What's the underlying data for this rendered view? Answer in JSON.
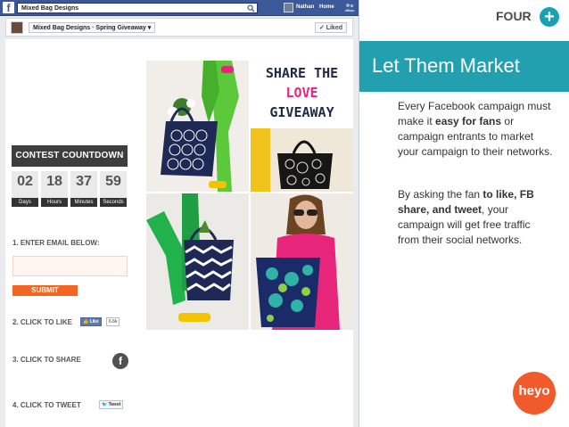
{
  "facebook": {
    "logo": "f",
    "search_value": "Mixed Bag Designs",
    "nav_user": "Nathan",
    "nav_home": "Home",
    "breadcrumb": "Mixed Bag Designs · Spring Giveaway ▾",
    "liked_button": "✓ Liked"
  },
  "campaign": {
    "headline": [
      "SHARE THE",
      "LOVE",
      "GIVEAWAY"
    ],
    "countdown_title": "CONTEST COUNTDOWN",
    "countdown": [
      {
        "value": "02",
        "unit": "Days"
      },
      {
        "value": "18",
        "unit": "Hours"
      },
      {
        "value": "37",
        "unit": "Minutes"
      },
      {
        "value": "59",
        "unit": "Seconds"
      }
    ],
    "step1": "1. ENTER EMAIL BELOW:",
    "submit": "SUBMIT",
    "step2": "2. CLICK TO LIKE",
    "like_button": "👍 Like",
    "like_count": "6.6k",
    "step3": "3. CLICK TO SHARE",
    "share_icon": "f",
    "step4": "4. CLICK TO TWEET",
    "tweet_button": "🐦 Tweet"
  },
  "slide": {
    "step_label": "FOUR",
    "plus_icon": "+",
    "title": "Let Them Market",
    "para1_a": "Every Facebook campaign must make it ",
    "para1_b": "easy for fans",
    "para1_c": " or campaign entrants to market your campaign to their networks.",
    "para2_a": "By asking the fan ",
    "para2_b": "to like, FB share, and tweet",
    "para2_c": ", your campaign will get free traffic from their social networks.",
    "logo": "heyo"
  },
  "colors": {
    "facebook_blue": "#3b5998",
    "accent_teal": "#23a0b0",
    "love_pink": "#e7257b",
    "submit_orange": "#f26522",
    "heyo_orange": "#f15a2b"
  }
}
